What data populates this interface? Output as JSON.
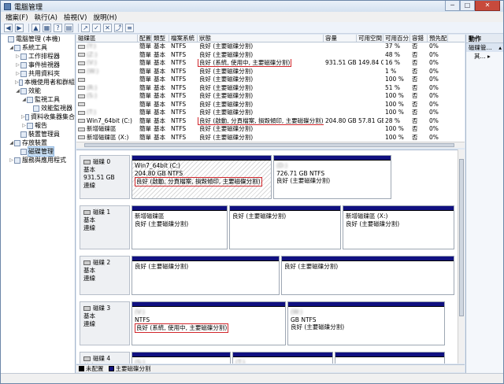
{
  "window": {
    "title": "電腦管理",
    "controls": {
      "minimize": "─",
      "maximize": "□",
      "close": "✕"
    }
  },
  "menu": [
    "檔案(F)",
    "執行(A)",
    "檢視(V)",
    "說明(H)"
  ],
  "tree": [
    {
      "label": "電腦管理 (本機)",
      "indent": 0,
      "exp": "",
      "icon": "computer-icon"
    },
    {
      "label": "系統工具",
      "indent": 1,
      "exp": "◢",
      "icon": "tools-icon"
    },
    {
      "label": "工作排程器",
      "indent": 2,
      "exp": "▷",
      "icon": "clock-icon"
    },
    {
      "label": "事件檢視器",
      "indent": 2,
      "exp": "▷",
      "icon": "event-icon"
    },
    {
      "label": "共用資料夾",
      "indent": 2,
      "exp": "▷",
      "icon": "folder-icon"
    },
    {
      "label": "本機使用者和群組",
      "indent": 2,
      "exp": "▷",
      "icon": "users-icon"
    },
    {
      "label": "效能",
      "indent": 2,
      "exp": "◢",
      "icon": "performance-icon"
    },
    {
      "label": "監視工具",
      "indent": 3,
      "exp": "◢",
      "icon": "monitor-icon"
    },
    {
      "label": "效能監視器",
      "indent": 4,
      "exp": "",
      "icon": "chart-icon"
    },
    {
      "label": "資料收集器集合",
      "indent": 3,
      "exp": "▷",
      "icon": "collector-icon"
    },
    {
      "label": "報告",
      "indent": 3,
      "exp": "▷",
      "icon": "report-icon"
    },
    {
      "label": "裝置管理員",
      "indent": 2,
      "exp": "",
      "icon": "device-icon"
    },
    {
      "label": "存放裝置",
      "indent": 1,
      "exp": "◢",
      "icon": "storage-icon"
    },
    {
      "label": "磁碟管理",
      "indent": 2,
      "exp": "",
      "icon": "disk-icon",
      "selected": true
    },
    {
      "label": "服務與應用程式",
      "indent": 1,
      "exp": "▷",
      "icon": "services-icon"
    }
  ],
  "volume_columns": [
    "磁碟區",
    "配置",
    "類型",
    "檔案系統",
    "狀態",
    "容量",
    "可用空間",
    "可用百分比",
    "容錯",
    "預先配置"
  ],
  "volumes": [
    {
      "name": "(Y:)",
      "layout": "簡單",
      "type": "基本",
      "fs": "NTFS",
      "status": "良好 (主要磁碟分割)",
      "cap": "",
      "free": "",
      "pct": "37 %",
      "ft": "否",
      "ovh": "0%",
      "blur_name": true,
      "blur_cap": true
    },
    {
      "name": "(Z:)",
      "layout": "簡單",
      "type": "基本",
      "fs": "NTFS",
      "status": "良好 (主要磁碟分割)",
      "cap": "",
      "free": "",
      "pct": "48 %",
      "ft": "否",
      "ovh": "0%",
      "blur_name": true,
      "blur_cap": true
    },
    {
      "name": "(V:)",
      "layout": "簡單",
      "type": "基本",
      "fs": "NTFS",
      "status": "良好 (系統, 使用中, 主要磁碟分割)",
      "cap": "931.51 GB",
      "free": "149.84 GB",
      "pct": "16 %",
      "ft": "否",
      "ovh": "0%",
      "blur_name": true,
      "blur_cap": false,
      "red": true
    },
    {
      "name": "(W:)",
      "layout": "簡單",
      "type": "基本",
      "fs": "NTFS",
      "status": "良好 (主要磁碟分割)",
      "cap": "",
      "free": "",
      "pct": "1 %",
      "ft": "否",
      "ovh": "0%",
      "blur_name": true,
      "blur_cap": true
    },
    {
      "name": "",
      "layout": "簡單",
      "type": "基本",
      "fs": "NTFS",
      "status": "良好 (主要磁碟分割)",
      "cap": "",
      "free": "",
      "pct": "100 %",
      "ft": "否",
      "ovh": "0%",
      "blur_name": true,
      "blur_cap": true
    },
    {
      "name": "(R:)",
      "layout": "簡單",
      "type": "基本",
      "fs": "NTFS",
      "status": "良好 (主要磁碟分割)",
      "cap": "",
      "free": "",
      "pct": "51 %",
      "ft": "否",
      "ovh": "0%",
      "blur_name": true,
      "blur_cap": true
    },
    {
      "name": "(S:)",
      "layout": "簡單",
      "type": "基本",
      "fs": "NTFS",
      "status": "良好 (主要磁碟分割)",
      "cap": "",
      "free": "",
      "pct": "100 %",
      "ft": "否",
      "ovh": "0%",
      "blur_name": true,
      "blur_cap": true
    },
    {
      "name": "",
      "layout": "簡單",
      "type": "基本",
      "fs": "NTFS",
      "status": "良好 (主要磁碟分割)",
      "cap": "",
      "free": "",
      "pct": "100 %",
      "ft": "否",
      "ovh": "0%",
      "blur_name": true,
      "blur_cap": true
    },
    {
      "name": "(T:)",
      "layout": "簡單",
      "type": "基本",
      "fs": "NTFS",
      "status": "良好 (主要磁碟分割)",
      "cap": "",
      "free": "",
      "pct": "100 %",
      "ft": "否",
      "ovh": "0%",
      "blur_name": true,
      "blur_cap": true
    },
    {
      "name": "Win7_64bit (C:)",
      "layout": "簡單",
      "type": "基本",
      "fs": "NTFS",
      "status": "良好 (啟動, 分頁檔案, 損毀傾印, 主要磁碟分割)",
      "cap": "204.80 GB",
      "free": "57.81 GB",
      "pct": "28 %",
      "ft": "否",
      "ovh": "0%",
      "blur_name": false,
      "blur_cap": false,
      "red": true
    },
    {
      "name": "新增磁碟區",
      "layout": "簡單",
      "type": "基本",
      "fs": "NTFS",
      "status": "良好 (主要磁碟分割)",
      "cap": "",
      "free": "",
      "pct": "100 %",
      "ft": "否",
      "ovh": "0%",
      "blur_name": false,
      "blur_cap": true
    },
    {
      "name": "新增磁碟區 (X:)",
      "layout": "簡單",
      "type": "基本",
      "fs": "NTFS",
      "status": "良好 (主要磁碟分割)",
      "cap": "",
      "free": "",
      "pct": "100 %",
      "ft": "否",
      "ovh": "0%",
      "blur_name": false,
      "blur_cap": true
    }
  ],
  "disks": [
    {
      "name": "磁碟 0",
      "type": "基本",
      "size": "931.51 GB",
      "state": "連線",
      "parts": [
        {
          "title": "Win7_64bit (C:)",
          "size": "204.80 GB NTFS",
          "status": "良好 (啟動, 分頁檔案, 損毀傾印, 主要磁碟分割)",
          "hatch": true,
          "red": true
        },
        {
          "title": "(D:)",
          "size": "726.71 GB NTFS",
          "status": "良好 (主要磁碟分割)",
          "blur_title": true
        }
      ]
    },
    {
      "name": "磁碟 1",
      "type": "基本",
      "size": "",
      "state": "連線",
      "parts": [
        {
          "title": "新增磁碟區",
          "size": "",
          "status": "良好 (主要磁碟分割)"
        },
        {
          "title": "",
          "size": "",
          "status": "良好 (主要磁碟分割)",
          "blur_title": true
        },
        {
          "title": "新增磁碟區 (X:)",
          "size": "",
          "status": "良好 (主要磁碟分割)"
        }
      ]
    },
    {
      "name": "磁碟 2",
      "type": "基本",
      "size": "",
      "state": "連線",
      "parts": [
        {
          "title": "",
          "size": "",
          "status": "良好 (主要磁碟分割)",
          "blur_title": true
        },
        {
          "title": "",
          "size": "",
          "status": "良好 (主要磁碟分割)",
          "blur_title": true
        }
      ]
    },
    {
      "name": "磁碟 3",
      "type": "基本",
      "size": "",
      "state": "連線",
      "parts": [
        {
          "title": "(V:)",
          "size": "NTFS",
          "status": "良好 (系統, 使用中, 主要磁碟分割)",
          "blur_title": true,
          "red": true
        },
        {
          "title": "(W:)",
          "size": "GB NTFS",
          "status": "良好 (主要磁碟分割)",
          "blur_title": true
        }
      ]
    },
    {
      "name": "磁碟 4",
      "type": "基本",
      "size": "",
      "state": "",
      "parts": [
        {
          "title": "(S:)",
          "size": "",
          "status": "",
          "blur_title": true
        },
        {
          "title": "(T:)",
          "size": "",
          "status": "",
          "blur_title": true
        },
        {
          "title": "",
          "size": "",
          "status": "",
          "blur_title": true
        }
      ]
    }
  ],
  "legend": {
    "unallocated": "未配置",
    "primary": "主要磁碟分割",
    "unallocated_color": "#000000",
    "primary_color": "#101080"
  },
  "actions": {
    "header": "動作",
    "section": "磁碟管...",
    "item": "其...",
    "section_arrow": "▴",
    "item_arrow": "▸"
  }
}
